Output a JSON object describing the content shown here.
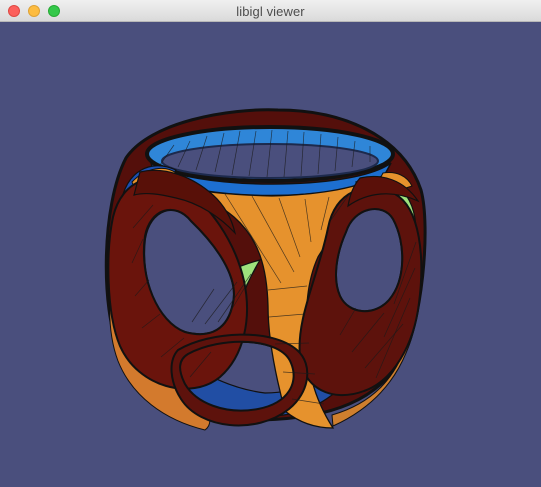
{
  "window": {
    "title": "libigl viewer",
    "controls": {
      "close": "close-control",
      "minimize": "minimize-control",
      "zoom": "zoom-control"
    }
  },
  "scene": {
    "background": "#4a4f7d",
    "colors": {
      "orange": "#e6922d",
      "dark_red": "#6a140c",
      "blue": "#2f86d8",
      "deep_blue": "#0e2e7a",
      "green": "#9ee27c",
      "edge": "#111111"
    }
  }
}
